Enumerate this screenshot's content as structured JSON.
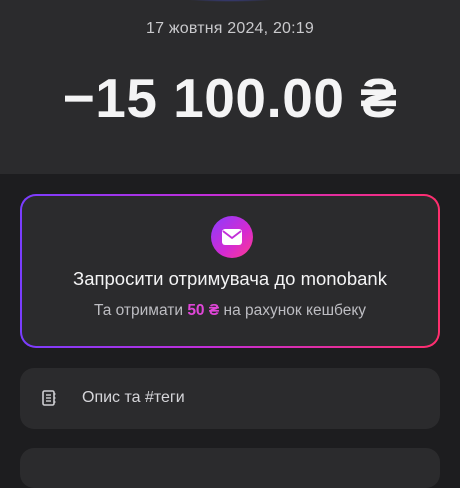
{
  "transaction": {
    "datetime": "17 жовтня 2024, 20:19",
    "amount": "−15 100.00 ₴"
  },
  "invite": {
    "icon": "envelope-icon",
    "title": "Запросити отримувача до monobank",
    "subtitle_before": "Та отримати ",
    "subtitle_highlight": "50 ₴",
    "subtitle_after": " на рахунок кешбеку",
    "gradient_colors": [
      "#7a3dff",
      "#c22ed8",
      "#ff2e6d"
    ]
  },
  "description": {
    "icon": "notes-icon",
    "label": "Опис та #теги"
  },
  "colors": {
    "background": "#1d1d1f",
    "surface": "#2b2b2d",
    "accent": "#e046d8"
  }
}
